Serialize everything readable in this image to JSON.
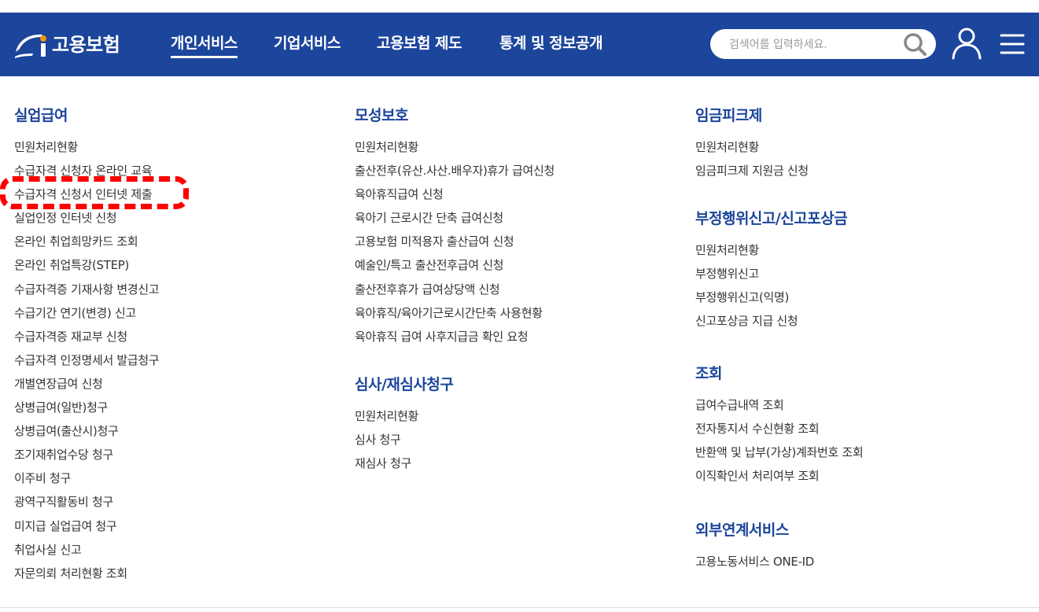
{
  "header": {
    "logo_text": "고용보험",
    "nav": [
      {
        "label": "개인서비스",
        "active": true
      },
      {
        "label": "기업서비스",
        "active": false
      },
      {
        "label": "고용보험 제도",
        "active": false
      },
      {
        "label": "통계 및 정보공개",
        "active": false
      }
    ],
    "search_placeholder": "검색어를 입력하세요.",
    "background_color": "#1c459c"
  },
  "sections": {
    "unemployment": {
      "title": "실업급여",
      "items": [
        "민원처리현황",
        "수급자격 신청자 온라인 교육",
        "수급자격 신청서 인터넷 제출",
        "실업인정 인터넷 신청",
        "온라인 취업희망카드 조회",
        "온라인 취업특강(STEP)",
        "수급자격증 기재사항 변경신고",
        "수급기간 연기(변경) 신고",
        "수급자격증 재교부 신청",
        "수급자격 인정명세서 발급청구",
        "개별연장급여 신청",
        "상병급여(일반)청구",
        "상병급여(출산시)청구",
        "조기재취업수당 청구",
        "이주비 청구",
        "광역구직활동비 청구",
        "미지급 실업급여 청구",
        "취업사실 신고",
        "자문의뢰 처리현황 조회"
      ]
    },
    "maternity": {
      "title": "모성보호",
      "items": [
        "민원처리현황",
        "출산전후(유산.사산.배우자)휴가 급여신청",
        "육아휴직급여 신청",
        "육아기 근로시간 단축 급여신청",
        "고용보험 미적용자 출산급여 신청",
        "예술인/특고 출산전후급여 신청",
        "출산전후휴가 급여상당액 신청",
        "육아휴직/육아기근로시간단축 사용현황",
        "육아휴직 급여 사후지급금 확인 요청"
      ]
    },
    "review": {
      "title": "심사/재심사청구",
      "items": [
        "민원처리현황",
        "심사 청구",
        "재심사 청구"
      ]
    },
    "wage_peak": {
      "title": "임금피크제",
      "items": [
        "민원처리현황",
        "임금피크제 지원금 신청"
      ]
    },
    "fraud_report": {
      "title": "부정행위신고/신고포상금",
      "items": [
        "민원처리현황",
        "부정행위신고",
        "부정행위신고(익명)",
        "신고포상금 지급 신청"
      ]
    },
    "inquiry": {
      "title": "조회",
      "items": [
        "급여수급내역 조회",
        "전자통지서 수신현황 조회",
        "반환액 및 납부(가상)계좌번호 조회",
        "이직확인서 처리여부 조회"
      ]
    },
    "external": {
      "title": "외부연계서비스",
      "items": [
        "고용노동서비스 ONE-ID"
      ]
    }
  },
  "annotation": {
    "highlight_color": "#ff0000",
    "highlighted_item": "수급자격 신청서 인터넷 제출"
  }
}
